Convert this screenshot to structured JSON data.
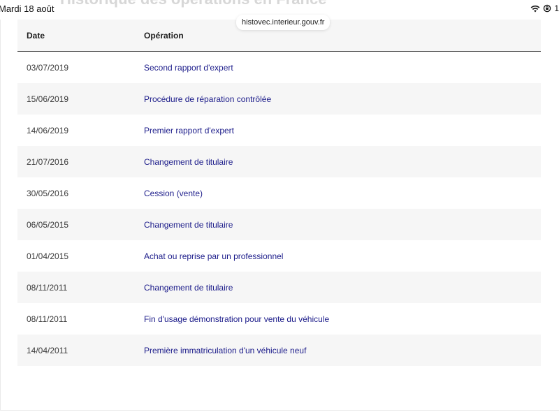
{
  "status_bar": {
    "time": "Mardi 18 août",
    "battery_text": "1"
  },
  "browser": {
    "url": "histovec.interieur.gouv.fr"
  },
  "page": {
    "heading": "Historique des opérations en France"
  },
  "table": {
    "headers": {
      "date": "Date",
      "operation": "Opération"
    },
    "rows": [
      {
        "date": "03/07/2019",
        "operation": "Second rapport d'expert"
      },
      {
        "date": "15/06/2019",
        "operation": "Procédure de réparation contrôlée"
      },
      {
        "date": "14/06/2019",
        "operation": "Premier rapport d'expert"
      },
      {
        "date": "21/07/2016",
        "operation": "Changement de titulaire"
      },
      {
        "date": "30/05/2016",
        "operation": "Cession (vente)"
      },
      {
        "date": "06/05/2015",
        "operation": "Changement de titulaire"
      },
      {
        "date": "01/04/2015",
        "operation": "Achat ou reprise par un professionnel"
      },
      {
        "date": "08/11/2011",
        "operation": "Changement de titulaire"
      },
      {
        "date": "08/11/2011",
        "operation": "Fin d'usage démonstration pour vente du véhicule"
      },
      {
        "date": "14/04/2011",
        "operation": "Première immatriculation d'un véhicule neuf"
      }
    ]
  },
  "icons": {
    "wifi": "wifi-icon",
    "lock": "lock-rotation-icon"
  },
  "colors": {
    "link": "#1c1c8a",
    "stripe": "#f6f6f6",
    "header_rule": "#3a3a3a"
  }
}
